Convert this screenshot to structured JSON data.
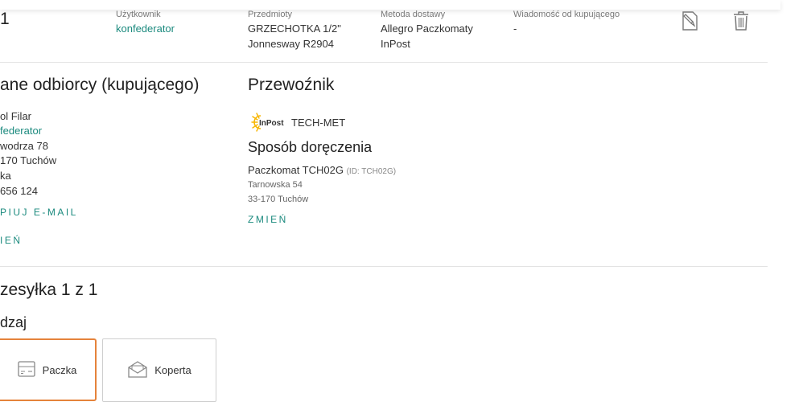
{
  "order": {
    "index_number": "1",
    "user": {
      "caption": "Użytkownik",
      "value": "konfederator"
    },
    "items": {
      "caption": "Przedmioty",
      "lines": [
        "GRZECHOTKA 1/2\"",
        "Jonneswaу R2904"
      ]
    },
    "delivery": {
      "caption": "Metoda dostawy",
      "lines": [
        "Allegro Paczkomaty",
        "InPost"
      ]
    },
    "message": {
      "caption": "Wiadomość od kupującego",
      "value": "-"
    },
    "actions": {
      "note_icon": "note-edit-icon",
      "delete_icon": "trash-icon"
    }
  },
  "buyer": {
    "title": "ane odbiorcy (kupującego)",
    "lines": [
      "ol Filar",
      "federator",
      "wodrza 78",
      "170 Tuchów",
      "ka",
      " 656 124"
    ],
    "copy_email": "PIUJ E-MAIL",
    "change": "IEŃ"
  },
  "carrier": {
    "title": "Przewoźnik",
    "logo_text": "InPost",
    "name": "TECH-MET",
    "delivery_title": "Sposób doręczenia",
    "locker": "Paczkomat TCH02G",
    "locker_id": "(ID: TCH02G)",
    "street": "Tarnowska 54",
    "city": "33-170 Tuchów",
    "change": "ZMIEŃ"
  },
  "shipment": {
    "title": "zesyłka 1 z 1",
    "type_label": "dzaj",
    "options": [
      {
        "label": "Paczka",
        "icon": "package-icon",
        "selected": true
      },
      {
        "label": "Koperta",
        "icon": "envelope-icon",
        "selected": false
      }
    ]
  },
  "colors": {
    "accent_link": "#1b8a7e",
    "selected_border": "#e5833b",
    "inpost_yellow": "#f7b500"
  }
}
